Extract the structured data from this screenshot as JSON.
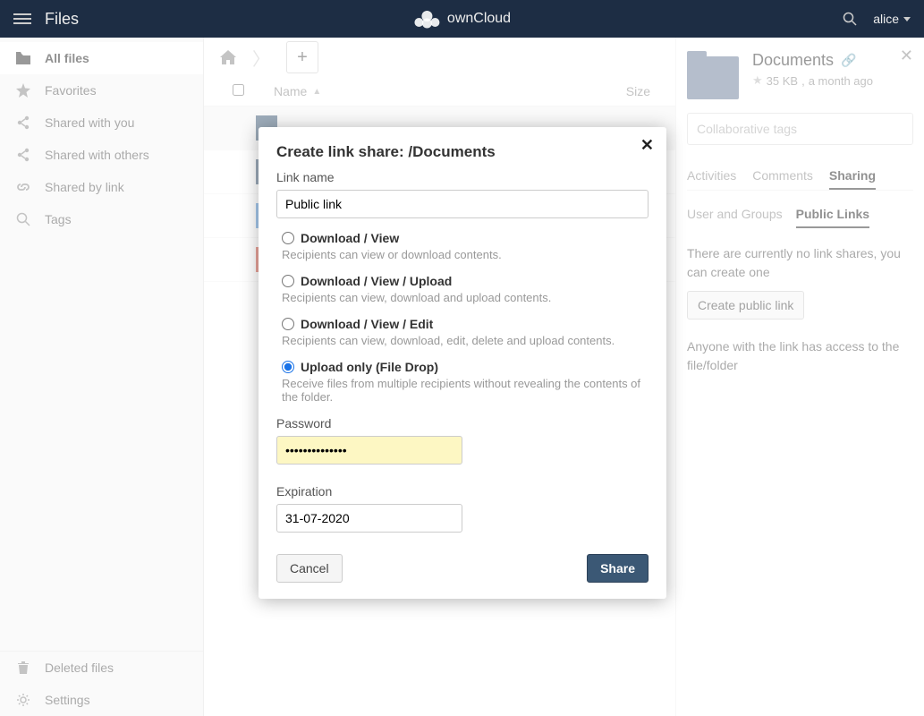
{
  "header": {
    "app_name": "Files",
    "brand": "ownCloud",
    "user": "alice"
  },
  "sidebar": {
    "items": [
      {
        "label": "All files"
      },
      {
        "label": "Favorites"
      },
      {
        "label": "Shared with you"
      },
      {
        "label": "Shared with others"
      },
      {
        "label": "Shared by link"
      },
      {
        "label": "Tags"
      }
    ],
    "bottom": [
      {
        "label": "Deleted files"
      },
      {
        "label": "Settings"
      }
    ]
  },
  "filelist": {
    "columns": {
      "name": "Name",
      "size": "Size"
    }
  },
  "details": {
    "title": "Documents",
    "size": "35 KB",
    "modified": "a month ago",
    "tags_placeholder": "Collaborative tags",
    "tabs": {
      "activities": "Activities",
      "comments": "Comments",
      "sharing": "Sharing"
    },
    "subtabs": {
      "usergroups": "User and Groups",
      "publiclinks": "Public Links"
    },
    "no_links_msg": "There are currently no link shares, you can create one",
    "create_link_btn": "Create public link",
    "access_note": "Anyone with the link has access to the file/folder"
  },
  "modal": {
    "title": "Create link share: /Documents",
    "link_name_label": "Link name",
    "link_name_value": "Public link",
    "options": [
      {
        "title": "Download / View",
        "desc": "Recipients can view or download contents."
      },
      {
        "title": "Download / View / Upload",
        "desc": "Recipients can view, download and upload contents."
      },
      {
        "title": "Download / View / Edit",
        "desc": "Recipients can view, download, edit, delete and upload contents."
      },
      {
        "title": "Upload only (File Drop)",
        "desc": "Receive files from multiple recipients without revealing the contents of the folder."
      }
    ],
    "password_label": "Password",
    "password_value": "••••••••••••••",
    "expiration_label": "Expiration",
    "expiration_value": "31-07-2020",
    "cancel": "Cancel",
    "share": "Share"
  }
}
